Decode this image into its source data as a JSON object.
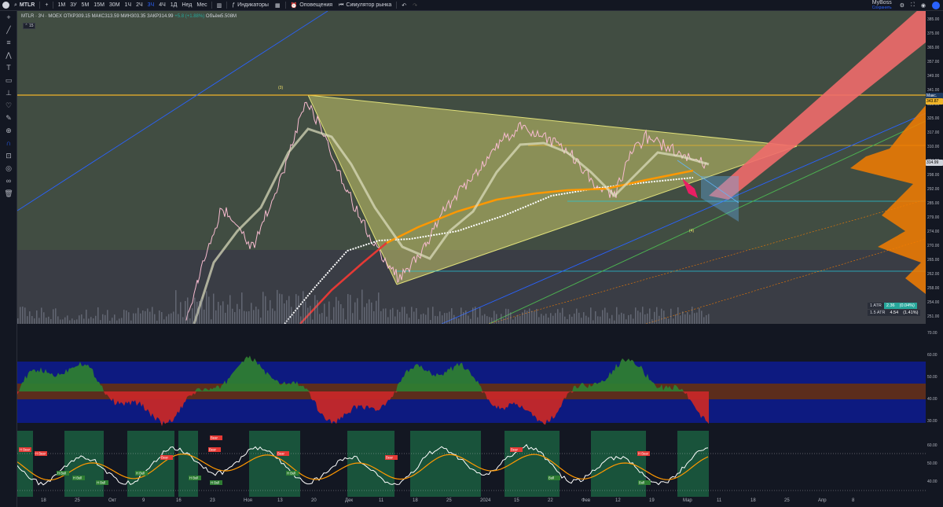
{
  "topbar": {
    "symbol": "MTLR",
    "add": "+",
    "timeframes": [
      "1М",
      "3У",
      "5М",
      "15М",
      "30М",
      "1Ч",
      "2Ч",
      "3Ч",
      "4Ч",
      "1Д",
      "Нед",
      "Мес"
    ],
    "active_timeframe": "3Ч",
    "indicators": "Индикаторы",
    "alerts": "Оповещения",
    "replay": "Симулятор рынка",
    "user_name": "MyBoss",
    "user_sub": "Сохранить"
  },
  "legend": {
    "title": "MTLR · 3Ч · MOEX",
    "open_label": "ОТКР",
    "open": "309.15",
    "high_label": "МАКС",
    "high": "313.59",
    "low_label": "МИН",
    "low": "303.35",
    "close_label": "ЗАКР",
    "close": "314.99",
    "change": "+5.8 (+1.88%)",
    "volume_label": "Объём",
    "volume": "5.508M",
    "collapse": "⌃ 15"
  },
  "atr": [
    {
      "label": "1 ATR",
      "v1": "2.36",
      "v2": "(0.04%)",
      "c1": "#26a69a",
      "c2": "#26a69a"
    },
    {
      "label": "1.5 ATR",
      "v1": "4.54",
      "v2": "(1.41%)",
      "c1": "#2a2e39",
      "c2": "#2a2e39"
    }
  ],
  "price_axis": {
    "ticks": [
      "385.00",
      "375.00",
      "365.00",
      "357.00",
      "349.00",
      "341.00",
      "333.00",
      "325.00",
      "317.00",
      "310.00",
      "304.00",
      "298.00",
      "292.00",
      "285.00",
      "279.00",
      "274.00",
      "270.00",
      "265.00",
      "262.00",
      "258.00",
      "254.00",
      "251.00"
    ],
    "high_tag": "Макс.",
    "high_value": "343.87",
    "last_value": "314.99"
  },
  "osc_axis": [
    "70.00",
    "60.00",
    "50.00",
    "40.00",
    "30.00"
  ],
  "bottom_axis": [
    "60.00",
    "50.00",
    "40.00"
  ],
  "time_axis": [
    "18",
    "25",
    "Окт",
    "9",
    "16",
    "23",
    "Ноя",
    "13",
    "20",
    "Дек",
    "11",
    "18",
    "25",
    "2024",
    "15",
    "22",
    "Фев",
    "12",
    "19",
    "Мар",
    "11",
    "18",
    "25",
    "Апр",
    "8"
  ],
  "labels_bear": [
    "H Bear",
    "H Bear",
    "Bear",
    "Bear",
    "Bear",
    "Bear",
    "Bear",
    "H Bear",
    "Bear"
  ],
  "labels_bull": [
    "H Bull",
    "H Bull",
    "H Bull",
    "H Bull",
    "H Bull",
    "H Bull",
    "H Bull",
    "Bull",
    "Bull"
  ],
  "wave_labels": [
    "(3)",
    "(4)"
  ],
  "colors": {
    "accent": "#2962ff",
    "bull": "#26a69a",
    "bear": "#ef5350"
  }
}
